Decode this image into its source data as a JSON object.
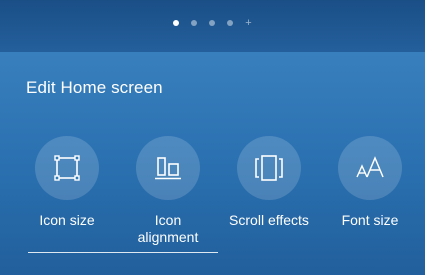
{
  "pager": {
    "pages": [
      "page-1",
      "page-2",
      "page-3",
      "page-4"
    ],
    "active_index": 0,
    "add_symbol": "+"
  },
  "panel": {
    "title": "Edit Home screen",
    "options": [
      {
        "label": "Icon size",
        "icon": "icon-size-icon"
      },
      {
        "label": "Icon\nalignment",
        "icon": "icon-alignment-icon"
      },
      {
        "label": "Scroll effects",
        "icon": "scroll-effects-icon"
      },
      {
        "label": "Font size",
        "icon": "font-size-icon"
      }
    ]
  },
  "colors": {
    "background": "#2a72b2",
    "text": "#ffffff"
  }
}
